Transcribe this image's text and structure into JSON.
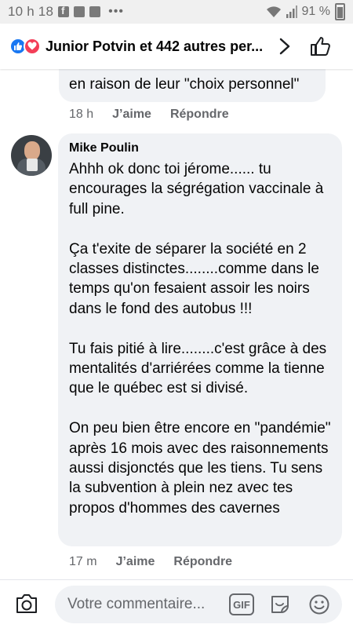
{
  "status_bar": {
    "time": "10 h 18",
    "notification_icons": [
      "facebook-icon",
      "gallery-icon",
      "mail-icon"
    ],
    "more": "•••",
    "battery": "91 %"
  },
  "header": {
    "reactions_text": "Junior Potvin et 442 autres per...",
    "reaction_icons": [
      "like-reaction-icon",
      "love-reaction-icon"
    ],
    "like_color": "#1877f2",
    "love_color": "#f33e58"
  },
  "previous_comment": {
    "text_tail": "en raison de leur \"choix personnel\"",
    "time": "18 h",
    "like_label": "J’aime",
    "reply_label": "Répondre"
  },
  "comment": {
    "author": "Mike Poulin",
    "paragraphs": [
      "Ahhh ok donc toi jérome...... tu encourages la ségrégation vaccinale à full pine.",
      "Ça t'exite de séparer la société en 2 classes distinctes........comme dans le temps qu'on fesaient assoir les noirs dans le fond des autobus !!!",
      "Tu fais pitié à lire........c'est grâce à des mentalités d'arriérées comme la tienne que le québec est si divisé.",
      "On peu bien être encore en \"pandémie\" après 16 mois avec des raisonnements aussi disjonctés que les tiens. Tu sens la subvention à plein nez avec tes propos d'hommes des cavernes"
    ],
    "time": "17 m",
    "like_label": "J’aime",
    "reply_label": "Répondre"
  },
  "composer": {
    "placeholder": "Votre commentaire...",
    "gif_label": "GIF"
  },
  "colors": {
    "bubble_bg": "#f0f2f5",
    "meta_text": "#65676b",
    "status_bar_bg": "#f0f0f0"
  }
}
